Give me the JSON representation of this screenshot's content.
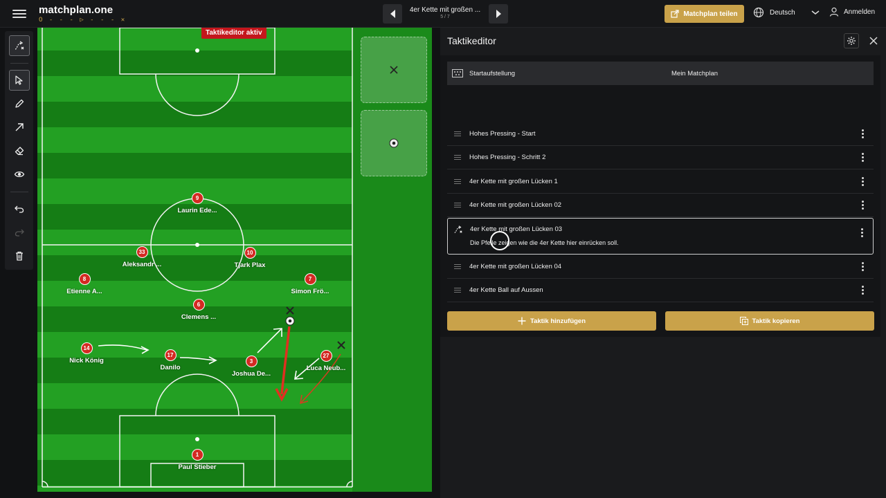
{
  "app": {
    "logo": "matchplan.one",
    "logo_sub": "O - - - ▷ - - - ✕"
  },
  "nav": {
    "title": "4er Kette mit großen ...",
    "counter": "5 / 7"
  },
  "header": {
    "share_label": "Matchplan teilen",
    "language": "Deutsch",
    "login_label": "Anmelden"
  },
  "pitch": {
    "badge": "Taktikeditor aktiv",
    "players": [
      {
        "num": "9",
        "name": "Laurin Ede..."
      },
      {
        "num": "33",
        "name": "Aleksandr ..."
      },
      {
        "num": "10",
        "name": "Tjark Plax"
      },
      {
        "num": "8",
        "name": "Etienne A..."
      },
      {
        "num": "7",
        "name": "Simon Frö..."
      },
      {
        "num": "6",
        "name": "Clemens ..."
      },
      {
        "num": "14",
        "name": "Nick König"
      },
      {
        "num": "17",
        "name": "Danilo"
      },
      {
        "num": "3",
        "name": "Joshua De..."
      },
      {
        "num": "27",
        "name": "Luca Neub..."
      },
      {
        "num": "1",
        "name": "Paul Stieber"
      }
    ]
  },
  "panel": {
    "title": "Taktikeditor",
    "start_label": "Startaufstellung",
    "start_value": "Mein Matchplan",
    "tactics": [
      {
        "label": "Hohes Pressing - Start"
      },
      {
        "label": "Hohes Pressing - Schritt 2"
      },
      {
        "label": "4er Kette mit großen Lücken 1"
      },
      {
        "label": "4er Kette mit großen Lücken 02"
      },
      {
        "label": "4er Kette mit großen Lücken 03",
        "description": "Die Pfeile zeigen wie die 4er Kette hier einrücken soll."
      },
      {
        "label": "4er Kette mit großen Lücken 04"
      },
      {
        "label": "4er Kette Ball auf Aussen"
      }
    ],
    "add_label": "Taktik hinzufügen",
    "copy_label": "Taktik kopieren"
  },
  "colors": {
    "accent": "#c9a24a",
    "player": "#d32a22",
    "badge": "#c4161c",
    "pitch_light": "#23a023",
    "pitch_dark": "#157d15"
  }
}
